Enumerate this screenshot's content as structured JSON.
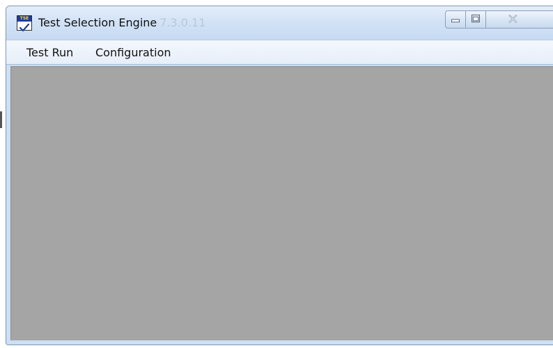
{
  "window": {
    "title": "Test Selection Engine",
    "version": "7.3.0.11",
    "app_icon": {
      "name": "tse-app-icon",
      "label": "TSE",
      "accent": "#1a3e9a",
      "label_color": "#ffdd33"
    },
    "caption_buttons": [
      {
        "name": "minimize-icon"
      },
      {
        "name": "maximize-icon"
      },
      {
        "name": "close-icon"
      }
    ]
  },
  "menu": {
    "items": [
      {
        "label": "Test Run"
      },
      {
        "label": "Configuration"
      }
    ]
  },
  "client_area": {
    "background": "#a5a5a5"
  }
}
